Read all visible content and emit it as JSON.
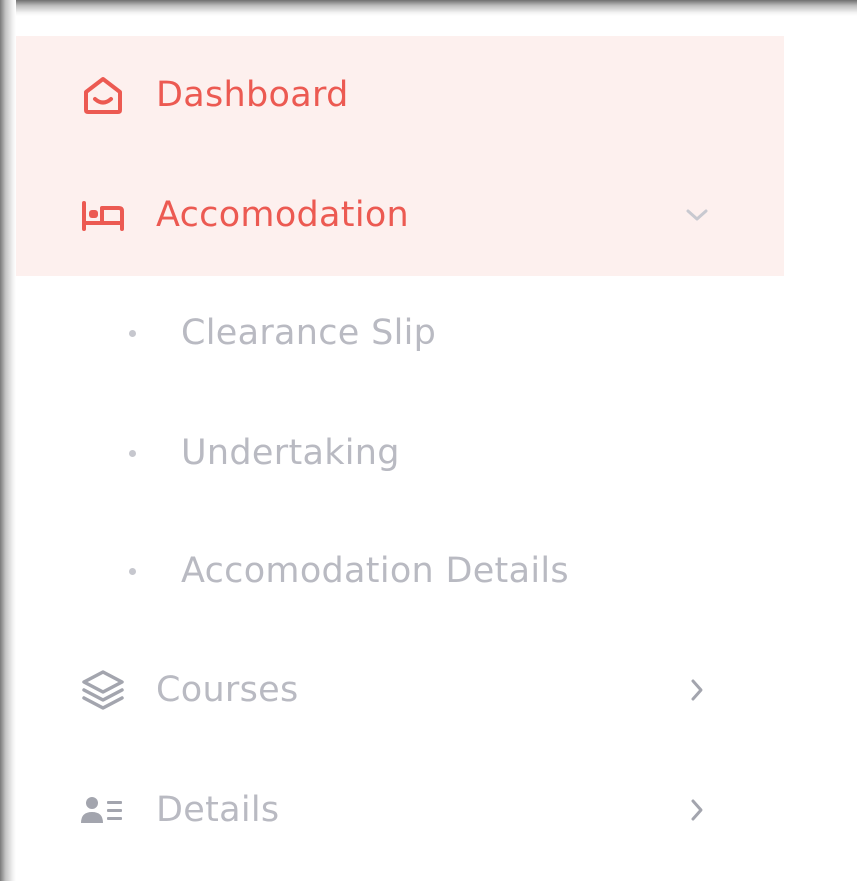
{
  "sidebar": {
    "items": [
      {
        "label": "Dashboard",
        "icon": "home-icon",
        "active": true,
        "color": "#ec5a52"
      },
      {
        "label": "Accomodation",
        "icon": "bed-icon",
        "active": true,
        "expanded": true,
        "color": "#ec5a52",
        "chevron": "chevron-down-icon",
        "children": [
          {
            "label": "Clearance Slip"
          },
          {
            "label": "Undertaking"
          },
          {
            "label": "Accomodation Details"
          }
        ]
      },
      {
        "label": "Courses",
        "icon": "layers-icon",
        "chevron": "chevron-right-icon"
      },
      {
        "label": "Details",
        "icon": "user-list-icon",
        "chevron": "chevron-right-icon"
      }
    ]
  },
  "colors": {
    "accent": "#ec5a52",
    "active_bg": "#fdf0ee",
    "muted_text": "#b9bac2",
    "icon_grey": "#a3a5ae"
  }
}
